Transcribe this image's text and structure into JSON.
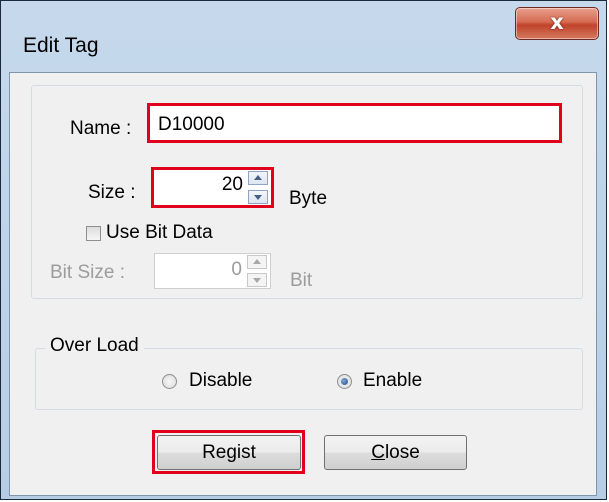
{
  "window": {
    "title": "Edit Tag",
    "close_glyph": "x"
  },
  "name_field": {
    "label": "Name :",
    "value": "D10000"
  },
  "size_field": {
    "label": "Size :",
    "value": "20",
    "unit": "Byte"
  },
  "use_bit_data": {
    "label": "Use Bit Data",
    "checked": false
  },
  "bit_size_field": {
    "label": "Bit Size :",
    "value": "0",
    "unit": "Bit"
  },
  "over_load": {
    "legend": "Over Load",
    "options": [
      {
        "label": "Disable",
        "selected": false
      },
      {
        "label": "Enable",
        "selected": true
      }
    ]
  },
  "buttons": {
    "regist": "Regist",
    "close_c": "C",
    "close_rest": "lose"
  },
  "colors": {
    "highlight": "#e0001b",
    "close_button": "#c9533b"
  }
}
